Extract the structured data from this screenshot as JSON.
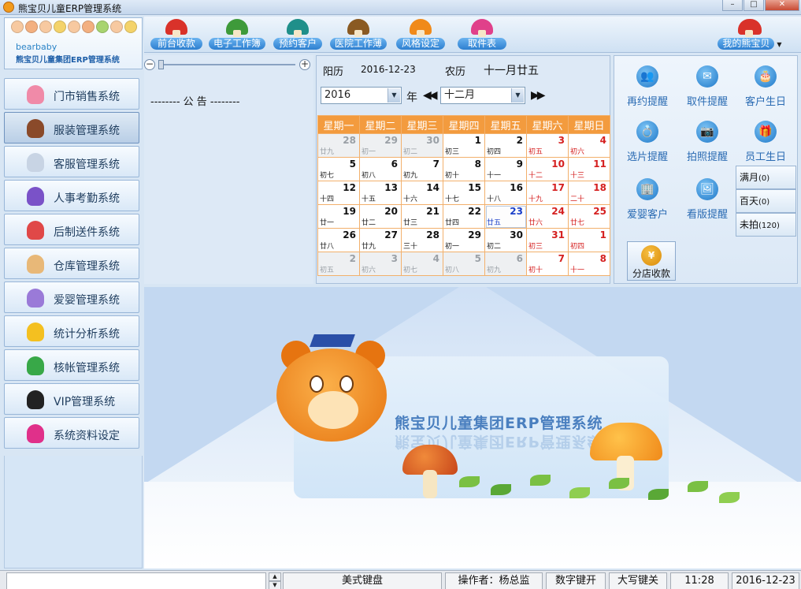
{
  "window": {
    "title": "熊宝贝儿童ERP管理系统",
    "controls": [
      "–",
      "□",
      "✕"
    ]
  },
  "brand": {
    "en": "bearbaby",
    "cn": "熊宝贝儿童集团ERP管理系统"
  },
  "toolbar": {
    "items": [
      {
        "label": "前台收款",
        "icon": "red-mushroom-icon",
        "color": "#d9322a"
      },
      {
        "label": "电子工作簿",
        "icon": "green-mushroom-icon",
        "color": "#3e9a3a"
      },
      {
        "label": "预约客户",
        "icon": "teal-mushroom-icon",
        "color": "#1f8f8a"
      },
      {
        "label": "医院工作薄",
        "icon": "brown-mushroom-icon",
        "color": "#8a5a22"
      },
      {
        "label": "风格设定",
        "icon": "orange-mushroom-icon",
        "color": "#f08a1a"
      },
      {
        "label": "取件表",
        "icon": "pink-mushroom-icon",
        "color": "#e0408a"
      }
    ],
    "my_bear": "我的熊宝贝"
  },
  "sidebar": {
    "items": [
      {
        "label": "门市销售系统",
        "icon": "pink-monster-icon",
        "color": "#f08aa8"
      },
      {
        "label": "服装管理系统",
        "icon": "brown-monster-icon",
        "color": "#8a4a2a"
      },
      {
        "label": "客服管理系统",
        "icon": "white-monster-icon",
        "color": "#c8d4e4"
      },
      {
        "label": "人事考勤系统",
        "icon": "purple-monster-icon",
        "color": "#7a52c8"
      },
      {
        "label": "后制送件系统",
        "icon": "red-monster-icon",
        "color": "#e04848"
      },
      {
        "label": "仓库管理系统",
        "icon": "beige-monster-icon",
        "color": "#e8b878"
      },
      {
        "label": "爱婴管理系统",
        "icon": "violet-monster-icon",
        "color": "#9a7ad8"
      },
      {
        "label": "统计分析系统",
        "icon": "yellow-monster-icon",
        "color": "#f4c020"
      },
      {
        "label": "核帐管理系统",
        "icon": "green-monster-icon",
        "color": "#38a848"
      },
      {
        "label": "VIP管理系统",
        "icon": "black-monster-icon",
        "color": "#222222"
      },
      {
        "label": "系统资料设定",
        "icon": "magenta-monster-icon",
        "color": "#e0308a"
      }
    ]
  },
  "notice": {
    "title": "-------- 公 告 --------"
  },
  "calendar": {
    "solar_label": "阳历",
    "solar_date": "2016-12-23",
    "lunar_label": "农历",
    "lunar_date": "十一月廿五",
    "year": "2016",
    "year_unit": "年",
    "month": "十二月",
    "weekdays": [
      "星期一",
      "星期二",
      "星期三",
      "星期四",
      "星期五",
      "星期六",
      "星期日"
    ],
    "weeks": [
      [
        {
          "d": "28",
          "l": "廿九",
          "t": "other"
        },
        {
          "d": "29",
          "l": "初一",
          "t": "other"
        },
        {
          "d": "30",
          "l": "初二",
          "t": "other"
        },
        {
          "d": "1",
          "l": "初三",
          "t": ""
        },
        {
          "d": "2",
          "l": "初四",
          "t": ""
        },
        {
          "d": "3",
          "l": "初五",
          "t": "red"
        },
        {
          "d": "4",
          "l": "初六",
          "t": "red"
        }
      ],
      [
        {
          "d": "5",
          "l": "初七",
          "t": ""
        },
        {
          "d": "6",
          "l": "初八",
          "t": ""
        },
        {
          "d": "7",
          "l": "初九",
          "t": ""
        },
        {
          "d": "8",
          "l": "初十",
          "t": ""
        },
        {
          "d": "9",
          "l": "十一",
          "t": ""
        },
        {
          "d": "10",
          "l": "十二",
          "t": "red"
        },
        {
          "d": "11",
          "l": "十三",
          "t": "red"
        }
      ],
      [
        {
          "d": "12",
          "l": "十四",
          "t": ""
        },
        {
          "d": "13",
          "l": "十五",
          "t": ""
        },
        {
          "d": "14",
          "l": "十六",
          "t": ""
        },
        {
          "d": "15",
          "l": "十七",
          "t": ""
        },
        {
          "d": "16",
          "l": "十八",
          "t": ""
        },
        {
          "d": "17",
          "l": "十九",
          "t": "red"
        },
        {
          "d": "18",
          "l": "二十",
          "t": "red"
        }
      ],
      [
        {
          "d": "19",
          "l": "廿一",
          "t": ""
        },
        {
          "d": "20",
          "l": "廿二",
          "t": ""
        },
        {
          "d": "21",
          "l": "廿三",
          "t": ""
        },
        {
          "d": "22",
          "l": "廿四",
          "t": ""
        },
        {
          "d": "23",
          "l": "廿五",
          "t": "blue"
        },
        {
          "d": "24",
          "l": "廿六",
          "t": "red"
        },
        {
          "d": "25",
          "l": "廿七",
          "t": "red"
        }
      ],
      [
        {
          "d": "26",
          "l": "廿八",
          "t": ""
        },
        {
          "d": "27",
          "l": "廿九",
          "t": ""
        },
        {
          "d": "28",
          "l": "三十",
          "t": ""
        },
        {
          "d": "29",
          "l": "初一",
          "t": ""
        },
        {
          "d": "30",
          "l": "初二",
          "t": ""
        },
        {
          "d": "31",
          "l": "初三",
          "t": "red"
        },
        {
          "d": "1",
          "l": "初四",
          "t": "red"
        }
      ],
      [
        {
          "d": "2",
          "l": "初五",
          "t": "other"
        },
        {
          "d": "3",
          "l": "初六",
          "t": "other"
        },
        {
          "d": "4",
          "l": "初七",
          "t": "other"
        },
        {
          "d": "5",
          "l": "初八",
          "t": "other"
        },
        {
          "d": "6",
          "l": "初九",
          "t": "other"
        },
        {
          "d": "7",
          "l": "初十",
          "t": "red"
        },
        {
          "d": "8",
          "l": "十一",
          "t": "red"
        }
      ]
    ]
  },
  "reminders": {
    "items": [
      {
        "label": "再约提醒",
        "icon": "people-icon",
        "glyph": "👥"
      },
      {
        "label": "取件提醒",
        "icon": "envelope-icon",
        "glyph": "✉"
      },
      {
        "label": "客户生日",
        "icon": "cake-icon",
        "glyph": "🎂"
      },
      {
        "label": "选片提醒",
        "icon": "ring-icon",
        "glyph": "💍"
      },
      {
        "label": "拍照提醒",
        "icon": "camera-icon",
        "glyph": "📷"
      },
      {
        "label": "员工生日",
        "icon": "gift-icon",
        "glyph": "🎁"
      },
      {
        "label": "爱婴客户",
        "icon": "building-icon",
        "glyph": "🏢"
      },
      {
        "label": "看版提醒",
        "icon": "photo-icon",
        "glyph": "🖼"
      }
    ],
    "counters": [
      {
        "label": "满月",
        "count": "(0)"
      },
      {
        "label": "百天",
        "count": "(0)"
      },
      {
        "label": "未拍",
        "count": "(120)"
      }
    ],
    "branch_pay": "分店收款",
    "branch_pay_glyph": "¥"
  },
  "banner": {
    "title": "熊宝贝儿童集团ERP管理系统"
  },
  "statusbar": {
    "keyboard": "美式键盘",
    "operator": "操作者：杨总监",
    "numlock": "数字键开",
    "capslock": "大写键关",
    "time": "11:28",
    "date": "2016-12-23"
  }
}
